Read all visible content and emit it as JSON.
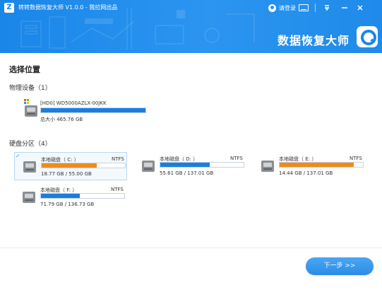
{
  "window": {
    "logo_text": "Z",
    "title": "转转数据恢复大师 V1.0.0 - 我拉网出品",
    "login_label": "请登录",
    "menu_icon": "menu-icon",
    "minimize_icon": "minimize-icon",
    "close_icon": "close-icon"
  },
  "header": {
    "brand_name": "数据恢复大师",
    "background_color": "#1a86e8"
  },
  "main": {
    "page_title": "选择位置",
    "physical_section": {
      "title": "物理设备（1）",
      "devices": [
        {
          "name": "[HD0] WD5000AZLX-00JKK",
          "size": "总大小 465.76 GB",
          "fill_fraction": 1.0,
          "bar_color": "#1a7ee0"
        }
      ]
    },
    "partition_section": {
      "title": "硬盘分区（4）",
      "partitions": [
        {
          "label": "本地磁盘（ C: ）",
          "fs": "NTFS",
          "usage": "18.77 GB / 55.00 GB",
          "fill_fraction": 0.66,
          "bar_color": "#f08a1a",
          "selected": true,
          "check": "✓"
        },
        {
          "label": "本地磁盘（ D: ）",
          "fs": "NTFS",
          "usage": "55.61 GB / 137.01 GB",
          "fill_fraction": 0.59,
          "bar_color": "#1a7ee0",
          "selected": false,
          "check": ""
        },
        {
          "label": "本地磁盘（ E: ）",
          "fs": "NTFS",
          "usage": "14.44 GB / 137.01 GB",
          "fill_fraction": 0.89,
          "bar_color": "#f08a1a",
          "selected": false,
          "check": ""
        },
        {
          "label": "本地磁盘（ F: ）",
          "fs": "NTFS",
          "usage": "71.79 GB / 136.73 GB",
          "fill_fraction": 0.47,
          "bar_color": "#1a7ee0",
          "selected": false,
          "check": ""
        }
      ]
    }
  },
  "footer": {
    "next_label": "下一步 >>"
  }
}
